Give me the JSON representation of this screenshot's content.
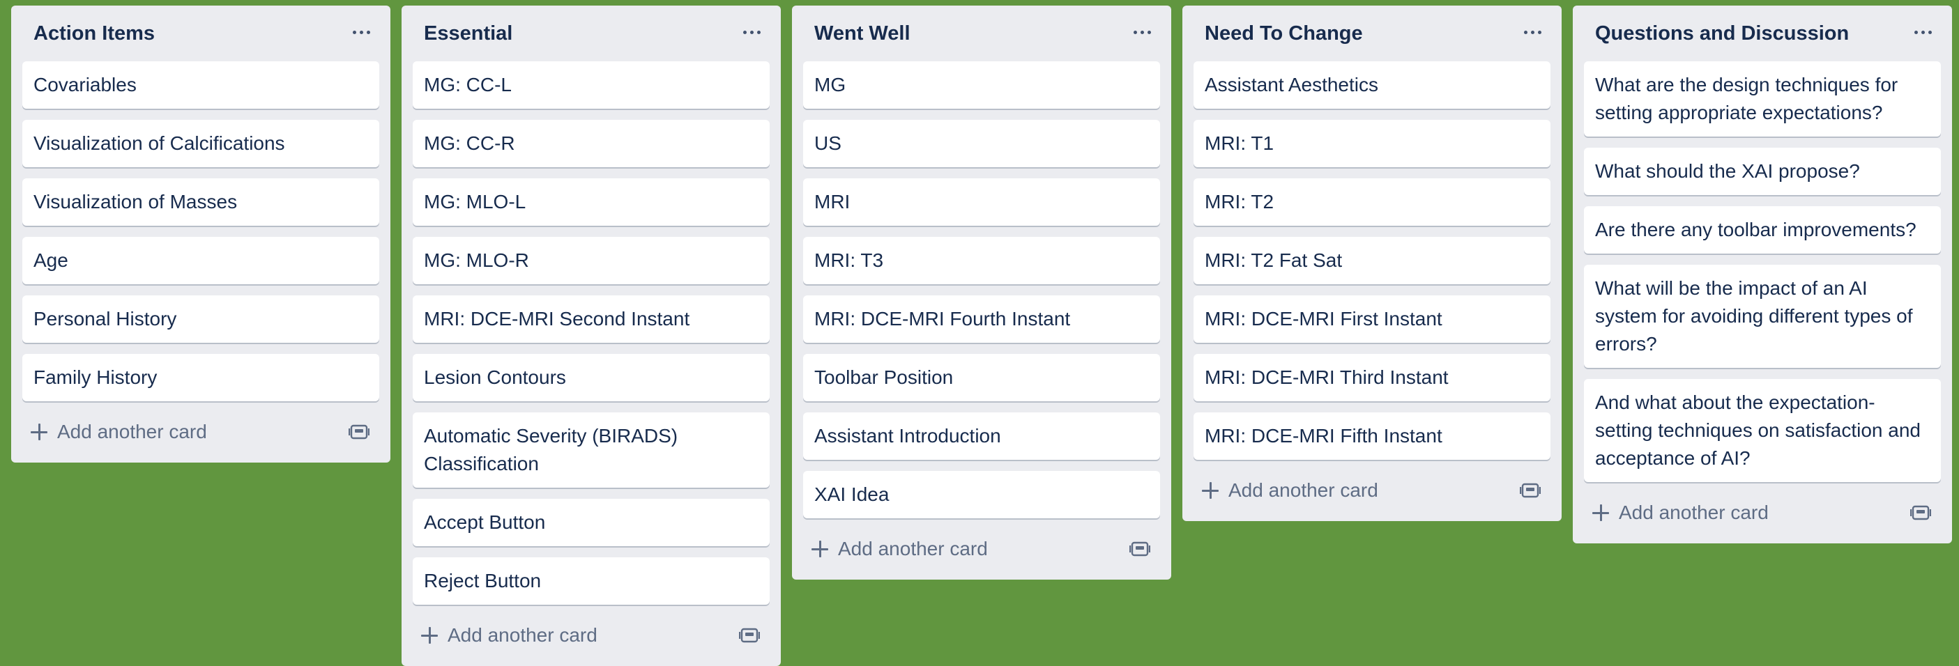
{
  "board": {
    "background_color": "#61963f",
    "lists": [
      {
        "title": "Action Items",
        "cards": [
          "Covariables",
          "Visualization of Calcifications",
          "Visualization of Masses",
          "Age",
          "Personal History",
          "Family History"
        ],
        "add_label": "Add another card"
      },
      {
        "title": "Essential",
        "cards": [
          "MG: CC-L",
          "MG: CC-R",
          "MG: MLO-L",
          "MG: MLO-R",
          "MRI: DCE-MRI Second Instant",
          "Lesion Contours",
          "Automatic Severity (BIRADS) Classification",
          "Accept Button",
          "Reject Button"
        ],
        "add_label": "Add another card"
      },
      {
        "title": "Went Well",
        "cards": [
          "MG",
          "US",
          "MRI",
          "MRI: T3",
          "MRI: DCE-MRI Fourth Instant",
          "Toolbar Position",
          "Assistant Introduction",
          "XAI Idea"
        ],
        "add_label": "Add another card"
      },
      {
        "title": "Need To Change",
        "cards": [
          "Assistant Aesthetics",
          "MRI: T1",
          "MRI: T2",
          "MRI: T2 Fat Sat",
          "MRI: DCE-MRI First Instant",
          "MRI: DCE-MRI Third Instant",
          "MRI: DCE-MRI Fifth Instant"
        ],
        "add_label": "Add another card"
      },
      {
        "title": "Questions and Discussion",
        "cards": [
          "What are the design techniques for setting appropriate expectations?",
          "What should the XAI propose?",
          "Are there any toolbar improvements?",
          "What will be the impact of an AI system for avoiding different types of errors?",
          "And what about the expectation-setting techniques on satisfaction and acceptance of AI?"
        ],
        "add_label": "Add another card"
      }
    ]
  },
  "icons": {
    "list_menu": "more-horizontal-icon",
    "add": "plus-icon",
    "template": "card-template-icon"
  }
}
